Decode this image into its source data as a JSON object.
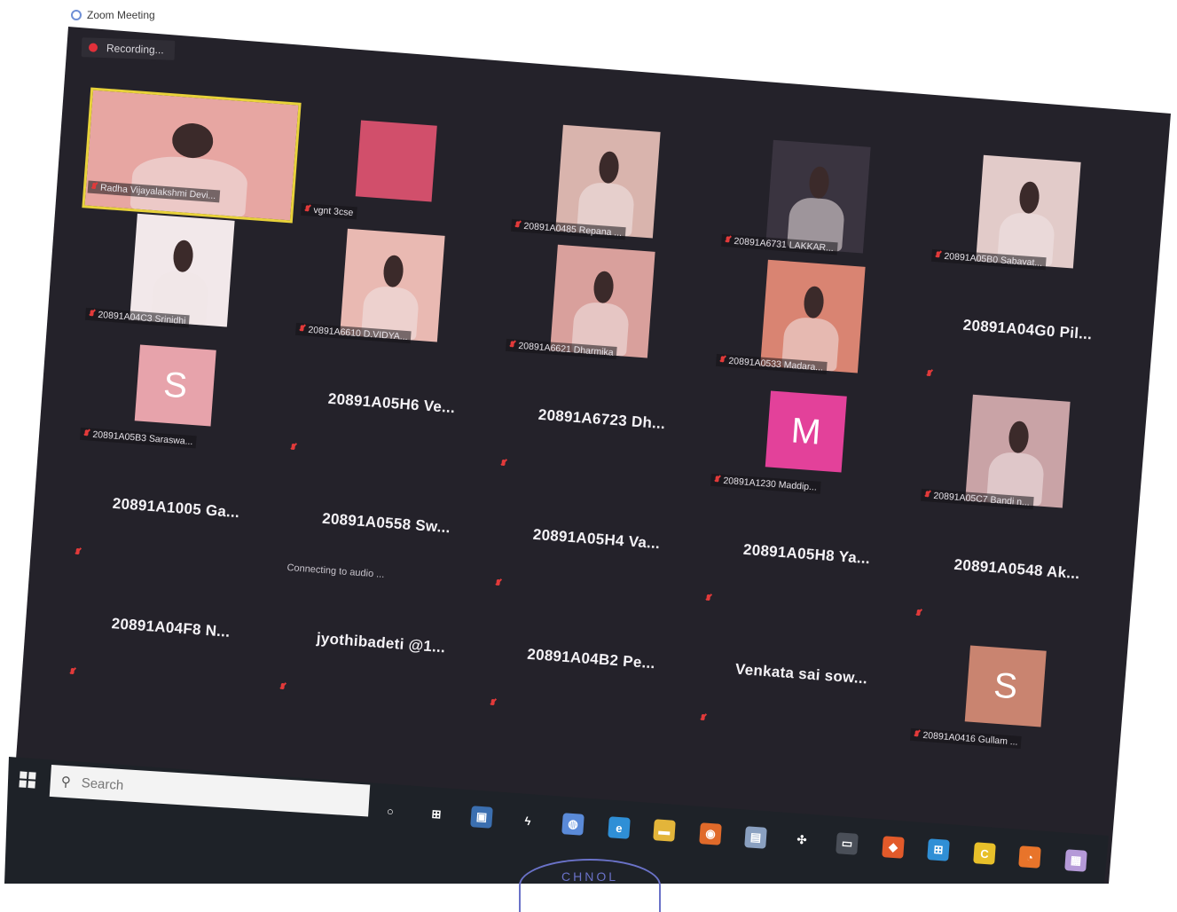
{
  "window": {
    "title": "Zoom Meeting",
    "recording_label": "Recording..."
  },
  "tiles": [
    {
      "name": "Radha Vijayalakshmi Devi...",
      "kind": "video",
      "active": true,
      "bg": "#e7a6a2"
    },
    {
      "name": "vgnt 3cse",
      "kind": "solid",
      "color": "#d14f6b"
    },
    {
      "name": "20891A0485 Repana ...",
      "kind": "video",
      "bg": "#d9b4ad"
    },
    {
      "name": "20891A6731 LAKKAR...",
      "kind": "video",
      "bg": "#3a3440"
    },
    {
      "name": "20891A05B0 Sabavat...",
      "kind": "video",
      "bg": "#e2cbc9"
    },
    {
      "name": "20891A04C3 Srinidhi",
      "kind": "video",
      "bg": "#f2e8ea"
    },
    {
      "name": "20891A6610 D.VIDYA...",
      "kind": "video",
      "bg": "#e9b9b2"
    },
    {
      "name": "20891A6621 Dharmika",
      "kind": "video",
      "bg": "#d9a09c"
    },
    {
      "name": "20891A0533 Madara...",
      "kind": "video",
      "bg": "#d98472"
    },
    {
      "name": "20891A04G0 Pil...",
      "kind": "name"
    },
    {
      "name": "20891A05B3 Saraswa...",
      "kind": "avatar",
      "letter": "S",
      "color": "#e7a3ab"
    },
    {
      "name": "20891A05H6 Ve...",
      "kind": "name"
    },
    {
      "name": "20891A6723 Dh...",
      "kind": "name"
    },
    {
      "name": "20891A1230 Maddip...",
      "kind": "avatar",
      "letter": "M",
      "color": "#e3419a"
    },
    {
      "name": "20891A05C7 Bandi n...",
      "kind": "video",
      "bg": "#c9a3a6"
    },
    {
      "name": "20891A1005 Ga...",
      "kind": "name"
    },
    {
      "name": "20891A0558 Sw...",
      "kind": "name",
      "status": "Connecting to audio ..."
    },
    {
      "name": "20891A05H4 Va...",
      "kind": "name"
    },
    {
      "name": "20891A05H8 Ya...",
      "kind": "name"
    },
    {
      "name": "20891A0548 Ak...",
      "kind": "name"
    },
    {
      "name": "20891A04F8 N...",
      "kind": "name"
    },
    {
      "name": "jyothibadeti @1...",
      "kind": "name"
    },
    {
      "name": "20891A04B2 Pe...",
      "kind": "name"
    },
    {
      "name": "Venkata sai sow...",
      "kind": "name"
    },
    {
      "name": "20891A0416 Gullam ...",
      "kind": "avatar",
      "letter": "S",
      "color": "#c98470"
    }
  ],
  "taskbar": {
    "search_placeholder": "Search",
    "icons": [
      {
        "icon": "cortana-icon",
        "glyph": "○",
        "color": "transparent"
      },
      {
        "icon": "task-view-icon",
        "glyph": "⊞",
        "color": "transparent"
      },
      {
        "icon": "store-icon",
        "glyph": "▣",
        "color": "#3b6fb0"
      },
      {
        "icon": "winamp-icon",
        "glyph": "ϟ",
        "color": "transparent"
      },
      {
        "icon": "app-blue-icon",
        "glyph": "◍",
        "color": "#5a8ad8"
      },
      {
        "icon": "edge-icon",
        "glyph": "e",
        "color": "#2f8fd6"
      },
      {
        "icon": "file-explorer-icon",
        "glyph": "▬",
        "color": "#e3b53a"
      },
      {
        "icon": "chrome-icon",
        "glyph": "◉",
        "color": "#e06a2a"
      },
      {
        "icon": "files-icon",
        "glyph": "▤",
        "color": "#8aa0c0"
      },
      {
        "icon": "dropbox-icon",
        "glyph": "✣",
        "color": "transparent"
      },
      {
        "icon": "terminal-icon",
        "glyph": "▭",
        "color": "#4a4f58"
      },
      {
        "icon": "app-orange-icon",
        "glyph": "◆",
        "color": "#e25a2a"
      },
      {
        "icon": "windows-icon",
        "glyph": "⊞",
        "color": "#2f8fd6"
      },
      {
        "icon": "app-yellow-icon",
        "glyph": "C",
        "color": "#e8c02a"
      },
      {
        "icon": "firefox-icon",
        "glyph": "◔",
        "color": "#e8742a"
      },
      {
        "icon": "zoom-icon",
        "glyph": "▦",
        "color": "#b59ad8"
      }
    ]
  },
  "stamp_text": "CHNOL"
}
